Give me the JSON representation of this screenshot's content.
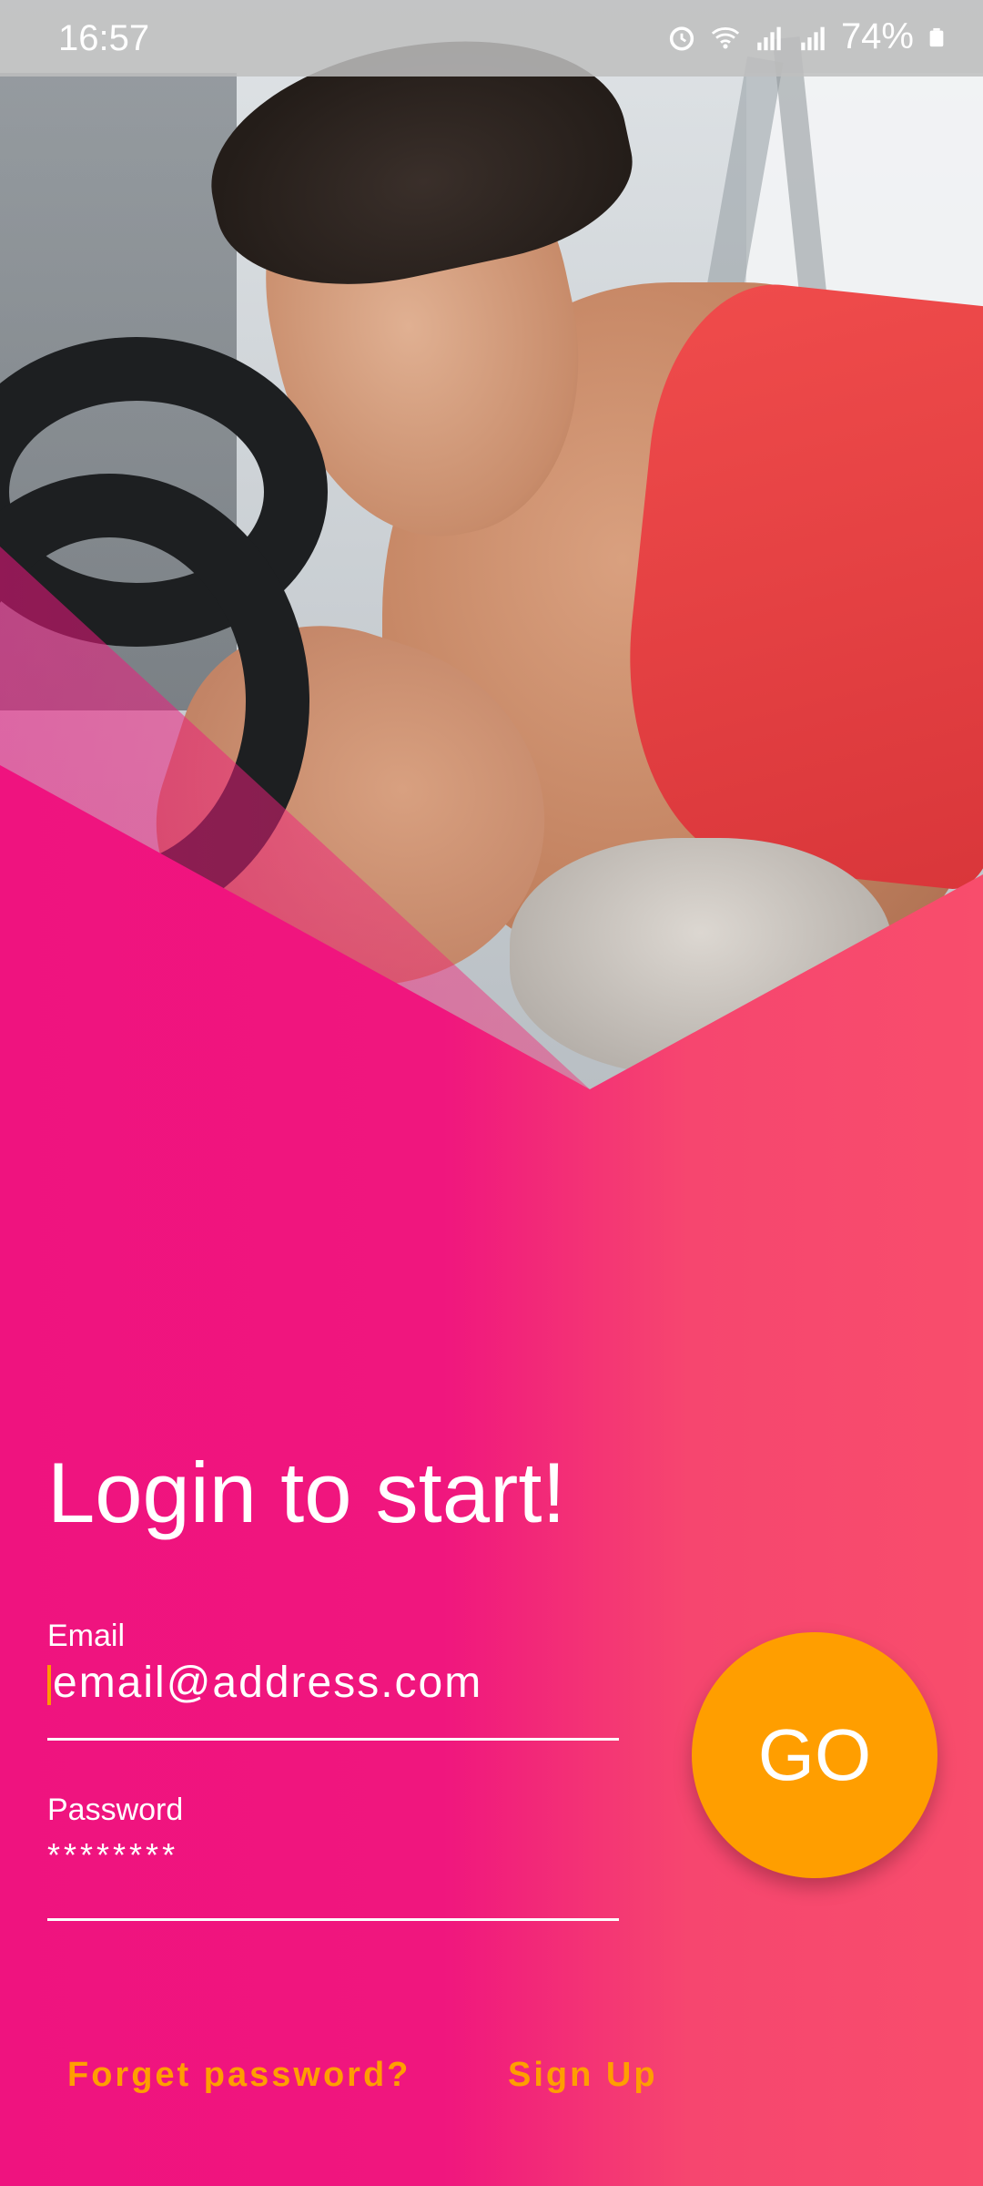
{
  "status_bar": {
    "time": "16:57",
    "battery": "74%",
    "icons": [
      "alarm-icon",
      "wifi-icon",
      "signal-icon",
      "signal-icon",
      "battery-icon"
    ]
  },
  "hero": {
    "image": "man-lifting-barbell-photo"
  },
  "login": {
    "title": "Login to start!",
    "email_label": "Email",
    "email_placeholder": "email@address.com",
    "password_label": "Password",
    "password_value": "********",
    "go_label": "GO"
  },
  "links": {
    "forgot_password": "Forget password?",
    "sign_up": "Sign Up"
  },
  "colors": {
    "gradient_start": "#ef137f",
    "gradient_end": "#f84d6c",
    "accent": "#ff9e00"
  }
}
